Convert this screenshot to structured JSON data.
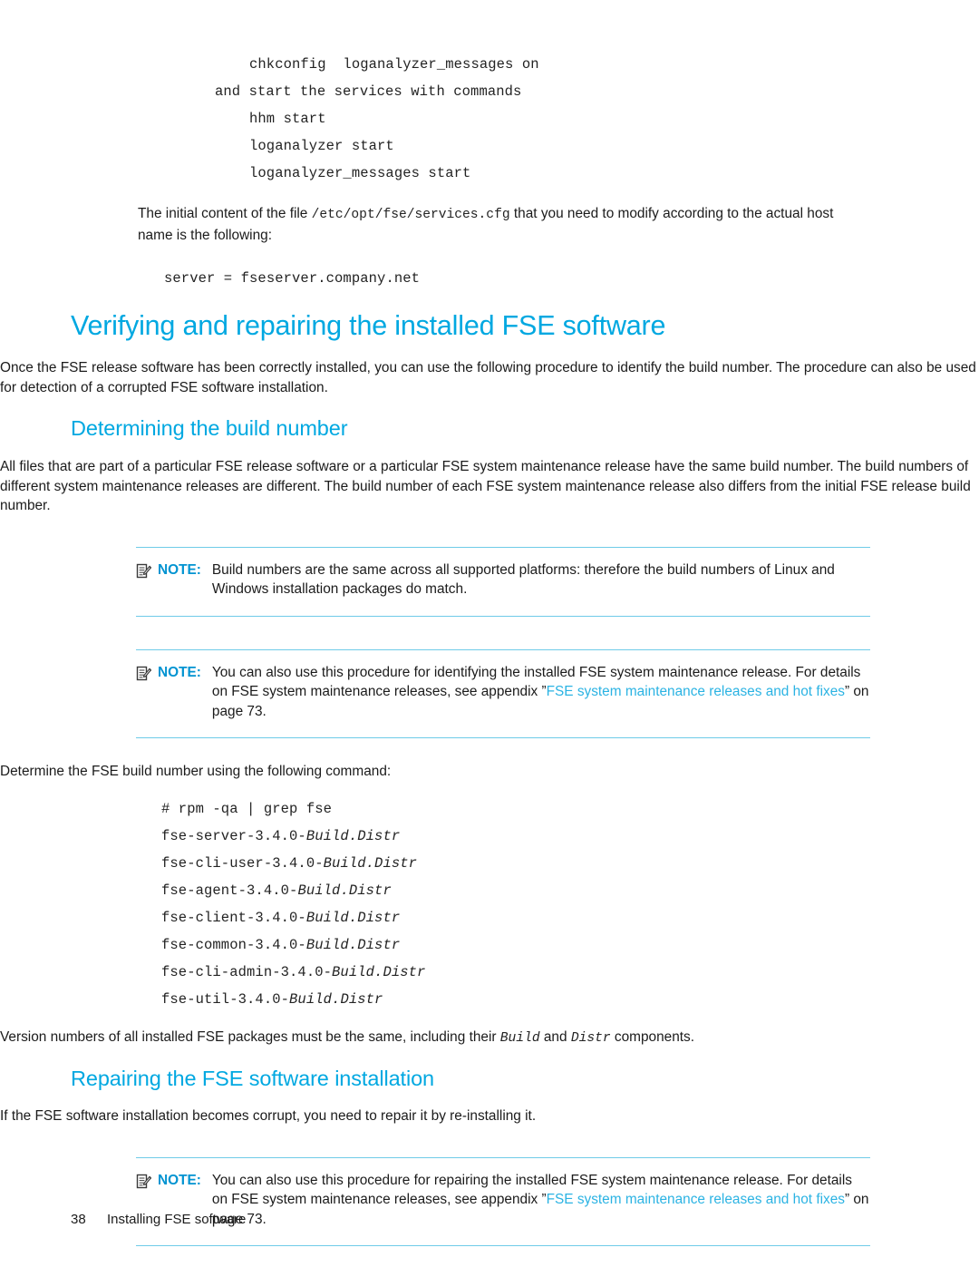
{
  "code_block_1": {
    "lines": [
      {
        "text": "chkconfig  loganalyzer_messages on",
        "indent": "a"
      },
      {
        "text": "and start the services with commands",
        "indent": "b"
      },
      {
        "text": "hhm start",
        "indent": "a"
      },
      {
        "text": "loganalyzer start",
        "indent": "a"
      },
      {
        "text": "loganalyzer_messages start",
        "indent": "a"
      }
    ]
  },
  "para_services_cfg": {
    "part1": "The initial content of the file ",
    "path": "/etc/opt/fse/services.cfg",
    "part2": " that you need to modify according to the actual host name is the following:"
  },
  "code_block_2": {
    "line": "server = fseserver.company.net"
  },
  "heading_verifying": "Verifying and repairing the installed FSE software",
  "para_once_installed": "Once the FSE release software has been correctly installed, you can use the following procedure to identify the build number. The procedure can also be used for detection of a corrupted FSE software installation.",
  "heading_determining": "Determining the build number",
  "para_all_files": "All files that are part of a particular FSE release software or a particular FSE system maintenance release have the same build number. The build numbers of different system maintenance releases are different. The build number of each FSE system maintenance release also differs from the initial FSE release build number.",
  "note_1": {
    "icon": "note-pencil-icon",
    "label": "NOTE:",
    "text": "Build numbers are the same across all supported platforms: therefore the build numbers of Linux and Windows installation packages do match."
  },
  "note_2": {
    "icon": "note-pencil-icon",
    "label": "NOTE:",
    "text_before": "You can also use this procedure for identifying the installed FSE system maintenance release. For details on FSE system maintenance releases, see appendix ”",
    "xref": "FSE system maintenance releases and hot fixes",
    "text_after": "” on page 73."
  },
  "para_determine_cmd": "Determine the FSE build number using the following command:",
  "code_block_3": {
    "command": "# rpm -qa | grep fse",
    "packages": [
      {
        "name": "fse-server-3.4.0-",
        "version": "Build.Distr"
      },
      {
        "name": "fse-cli-user-3.4.0-",
        "version": "Build.Distr"
      },
      {
        "name": "fse-agent-3.4.0-",
        "version": "Build.Distr"
      },
      {
        "name": "fse-client-3.4.0-",
        "version": "Build.Distr"
      },
      {
        "name": "fse-common-3.4.0-",
        "version": "Build.Distr"
      },
      {
        "name": "fse-cli-admin-3.4.0-",
        "version": "Build.Distr"
      },
      {
        "name": "fse-util-3.4.0-",
        "version": "Build.Distr"
      }
    ]
  },
  "para_version_numbers": {
    "part1": "Version numbers of all installed FSE packages must be the same, including their ",
    "mono1": "Build",
    "part2": " and ",
    "mono2": "Distr",
    "part3": " components."
  },
  "heading_repairing": "Repairing the FSE software installation",
  "para_if_corrupt": "If the FSE software installation becomes corrupt, you need to repair it by re-installing it.",
  "note_3": {
    "icon": "note-pencil-icon",
    "label": "NOTE:",
    "text_before": "You can also use this procedure for repairing the installed FSE system maintenance release. For details on FSE system maintenance releases, see appendix ”",
    "xref": "FSE system maintenance releases and hot fixes",
    "text_after": "” on page 73."
  },
  "footer": {
    "page_number": "38",
    "section": "Installing FSE software"
  },
  "colors": {
    "heading_blue": "#00a8e1",
    "note_label_blue": "#0093d1",
    "xref_blue": "#2bb3e3",
    "rule_blue": "#6fcbe8",
    "body_text": "#1b1b1b"
  }
}
